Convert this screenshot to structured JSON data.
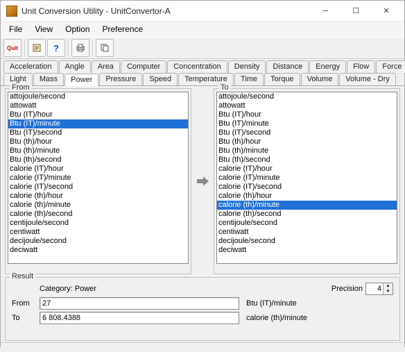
{
  "window": {
    "title": "Unit Conversion Utility - UnitConvertor-A"
  },
  "menu": {
    "file": "File",
    "view": "View",
    "option": "Option",
    "preference": "Preference"
  },
  "toolbar": {
    "quit": "Quit"
  },
  "tabs_row1": [
    "Acceleration",
    "Angle",
    "Area",
    "Computer",
    "Concentration",
    "Density",
    "Distance",
    "Energy",
    "Flow",
    "Force"
  ],
  "tabs_row2": [
    "Light",
    "Mass",
    "Power",
    "Pressure",
    "Speed",
    "Temperature",
    "Time",
    "Torque",
    "Volume",
    "Volume - Dry"
  ],
  "active_tab": "Power",
  "groups": {
    "from": "From",
    "to": "To",
    "result": "Result"
  },
  "units": [
    "attojoule/second",
    "attowatt",
    "Btu (IT)/hour",
    "Btu (IT)/minute",
    "Btu (IT)/second",
    "Btu (th)/hour",
    "Btu (th)/minute",
    "Btu (th)/second",
    "calorie (IT)/hour",
    "calorie (IT)/minute",
    "calorie (IT)/second",
    "calorie (th)/hour",
    "calorie (th)/minute",
    "calorie (th)/second",
    "centijoule/second",
    "centiwatt",
    "decijoule/second",
    "deciwatt"
  ],
  "from_selected": "Btu (IT)/minute",
  "to_selected": "calorie (th)/minute",
  "result": {
    "category_label": "Category:",
    "category_value": "Power",
    "from_label": "From",
    "from_value": "27",
    "from_unit": "Btu (IT)/minute",
    "to_label": "To",
    "to_value": "6 808.4388",
    "to_unit": "calorie (th)/minute",
    "precision_label": "Precision",
    "precision_value": "4"
  }
}
